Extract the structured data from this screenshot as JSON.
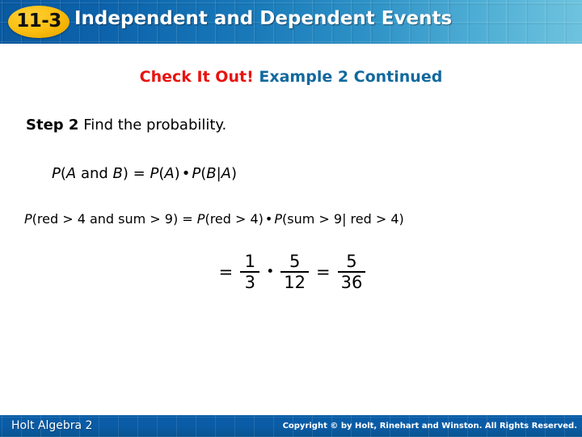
{
  "header": {
    "badge_number": "11-3",
    "title": "Independent and Dependent Events",
    "gradient_start": "#0a59a0",
    "gradient_end": "#6ec3de",
    "badge_color": "#f0ad00"
  },
  "slide": {
    "subtitle_highlight": "Check It Out!",
    "subtitle_rest": "Example 2 Continued",
    "subtitle_highlight_color": "#e8130f",
    "subtitle_rest_color": "#12699e",
    "step_label": "Step 2",
    "step_text": "Find the probability.",
    "formula_general": {
      "p1": "P",
      "open1": "(",
      "var_a": "A",
      "and": " and ",
      "var_b": "B",
      "close1": ")",
      "equals": " = ",
      "p2": "P",
      "open2": "(",
      "var_a2": "A",
      "close2": ")",
      "dot": "•",
      "p3": "P",
      "open3": "(",
      "var_b2": "B",
      "pipe": "|",
      "var_a3": "A",
      "close3": ")"
    },
    "formula_applied": {
      "p1": "P",
      "left_event": "(red > 4 and sum > 9)",
      "equals": " = ",
      "p2": "P",
      "first_event": "(red > 4)",
      "dot": "•",
      "p3": "P",
      "second_event": "(sum > 9| red > 4)"
    },
    "computation": {
      "equals_1": "=",
      "fraction_1": {
        "numerator": "1",
        "denominator": "3"
      },
      "dot": "•",
      "fraction_2": {
        "numerator": "5",
        "denominator": "12"
      },
      "equals_2": "=",
      "fraction_3": {
        "numerator": "5",
        "denominator": "36"
      }
    }
  },
  "footer": {
    "book_title": "Holt Algebra 2",
    "copyright": "Copyright © by Holt, Rinehart and Winston. All Rights Reserved.",
    "band_color": "#0a5ca6"
  }
}
